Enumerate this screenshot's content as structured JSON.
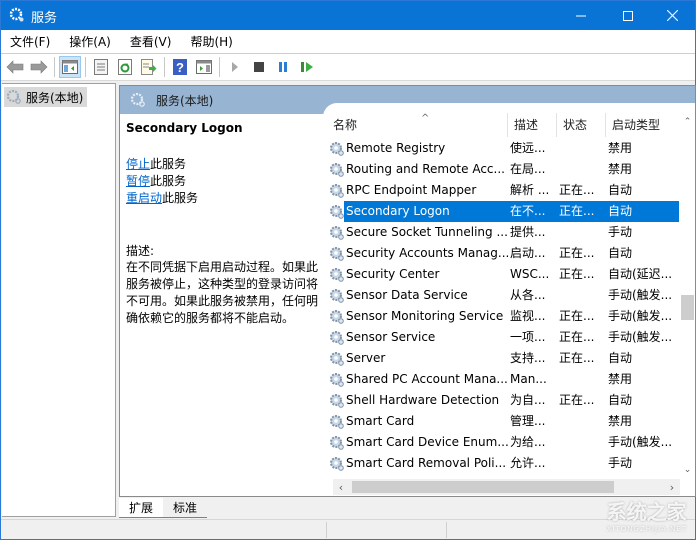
{
  "window": {
    "title": "服务",
    "controls": {
      "minimize": "minimize",
      "maximize": "maximize",
      "close": "close"
    }
  },
  "menu": [
    {
      "label": "文件(F)"
    },
    {
      "label": "操作(A)"
    },
    {
      "label": "查看(V)"
    },
    {
      "label": "帮助(H)"
    }
  ],
  "toolbar": {
    "buttons": [
      "back-arrow",
      "forward-arrow",
      "show-hide-console-tree",
      "properties",
      "refresh",
      "export-list",
      "help",
      "show-hide-action-pane",
      "start-service",
      "stop-service",
      "pause-service",
      "restart-service"
    ]
  },
  "tree": {
    "items": [
      {
        "label": "服务(本地)",
        "selected": true
      }
    ]
  },
  "panel": {
    "header_title": "服务(本地)",
    "selected_service": "Secondary Logon",
    "actions": [
      {
        "link": "停止",
        "suffix": "此服务"
      },
      {
        "link": "暂停",
        "suffix": "此服务"
      },
      {
        "link": "重启动",
        "suffix": "此服务"
      }
    ],
    "description_label": "描述:",
    "description": "在不同凭据下启用启动过程。如果此服务被停止，这种类型的登录访问将不可用。如果此服务被禁用，任何明确依赖它的服务都将不能启动。"
  },
  "list": {
    "columns": [
      {
        "label": "名称",
        "sorted": "ascending"
      },
      {
        "label": "描述"
      },
      {
        "label": "状态"
      },
      {
        "label": "启动类型"
      }
    ],
    "rows": [
      {
        "name": "Remote Registry",
        "desc": "使远...",
        "status": "",
        "startup": "禁用"
      },
      {
        "name": "Routing and Remote Acc...",
        "desc": "在局...",
        "status": "",
        "startup": "禁用"
      },
      {
        "name": "RPC Endpoint Mapper",
        "desc": "解析 ...",
        "status": "正在...",
        "startup": "自动"
      },
      {
        "name": "Secondary Logon",
        "desc": "在不...",
        "status": "正在...",
        "startup": "自动",
        "selected": true
      },
      {
        "name": "Secure Socket Tunneling ...",
        "desc": "提供...",
        "status": "",
        "startup": "手动"
      },
      {
        "name": "Security Accounts Manag...",
        "desc": "启动...",
        "status": "正在...",
        "startup": "自动"
      },
      {
        "name": "Security Center",
        "desc": "WSC...",
        "status": "正在...",
        "startup": "自动(延迟..."
      },
      {
        "name": "Sensor Data Service",
        "desc": "从各...",
        "status": "",
        "startup": "手动(触发..."
      },
      {
        "name": "Sensor Monitoring Service",
        "desc": "监视...",
        "status": "正在...",
        "startup": "手动(触发..."
      },
      {
        "name": "Sensor Service",
        "desc": "一项...",
        "status": "正在...",
        "startup": "手动(触发..."
      },
      {
        "name": "Server",
        "desc": "支持...",
        "status": "正在...",
        "startup": "自动"
      },
      {
        "name": "Shared PC Account Mana...",
        "desc": "Man...",
        "status": "",
        "startup": "禁用"
      },
      {
        "name": "Shell Hardware Detection",
        "desc": "为自...",
        "status": "正在...",
        "startup": "自动"
      },
      {
        "name": "Smart Card",
        "desc": "管理...",
        "status": "",
        "startup": "禁用"
      },
      {
        "name": "Smart Card Device Enum...",
        "desc": "为给...",
        "status": "",
        "startup": "手动(触发..."
      },
      {
        "name": "Smart Card Removal Poli...",
        "desc": "允许...",
        "status": "",
        "startup": "手动"
      }
    ],
    "vertical_scroll_position": 0.5,
    "horizontal_scroll_fraction": 0.78
  },
  "tabs": [
    {
      "label": "扩展",
      "active": true
    },
    {
      "label": "标准",
      "active": false
    }
  ],
  "watermark": {
    "text": "系统之家",
    "subtext": "XITONGZHIJIA.NET"
  },
  "colors": {
    "titlebar": "#0a74d6",
    "selection": "#0078d7",
    "panel_header": "#97b4d2",
    "link": "#0066cc"
  }
}
